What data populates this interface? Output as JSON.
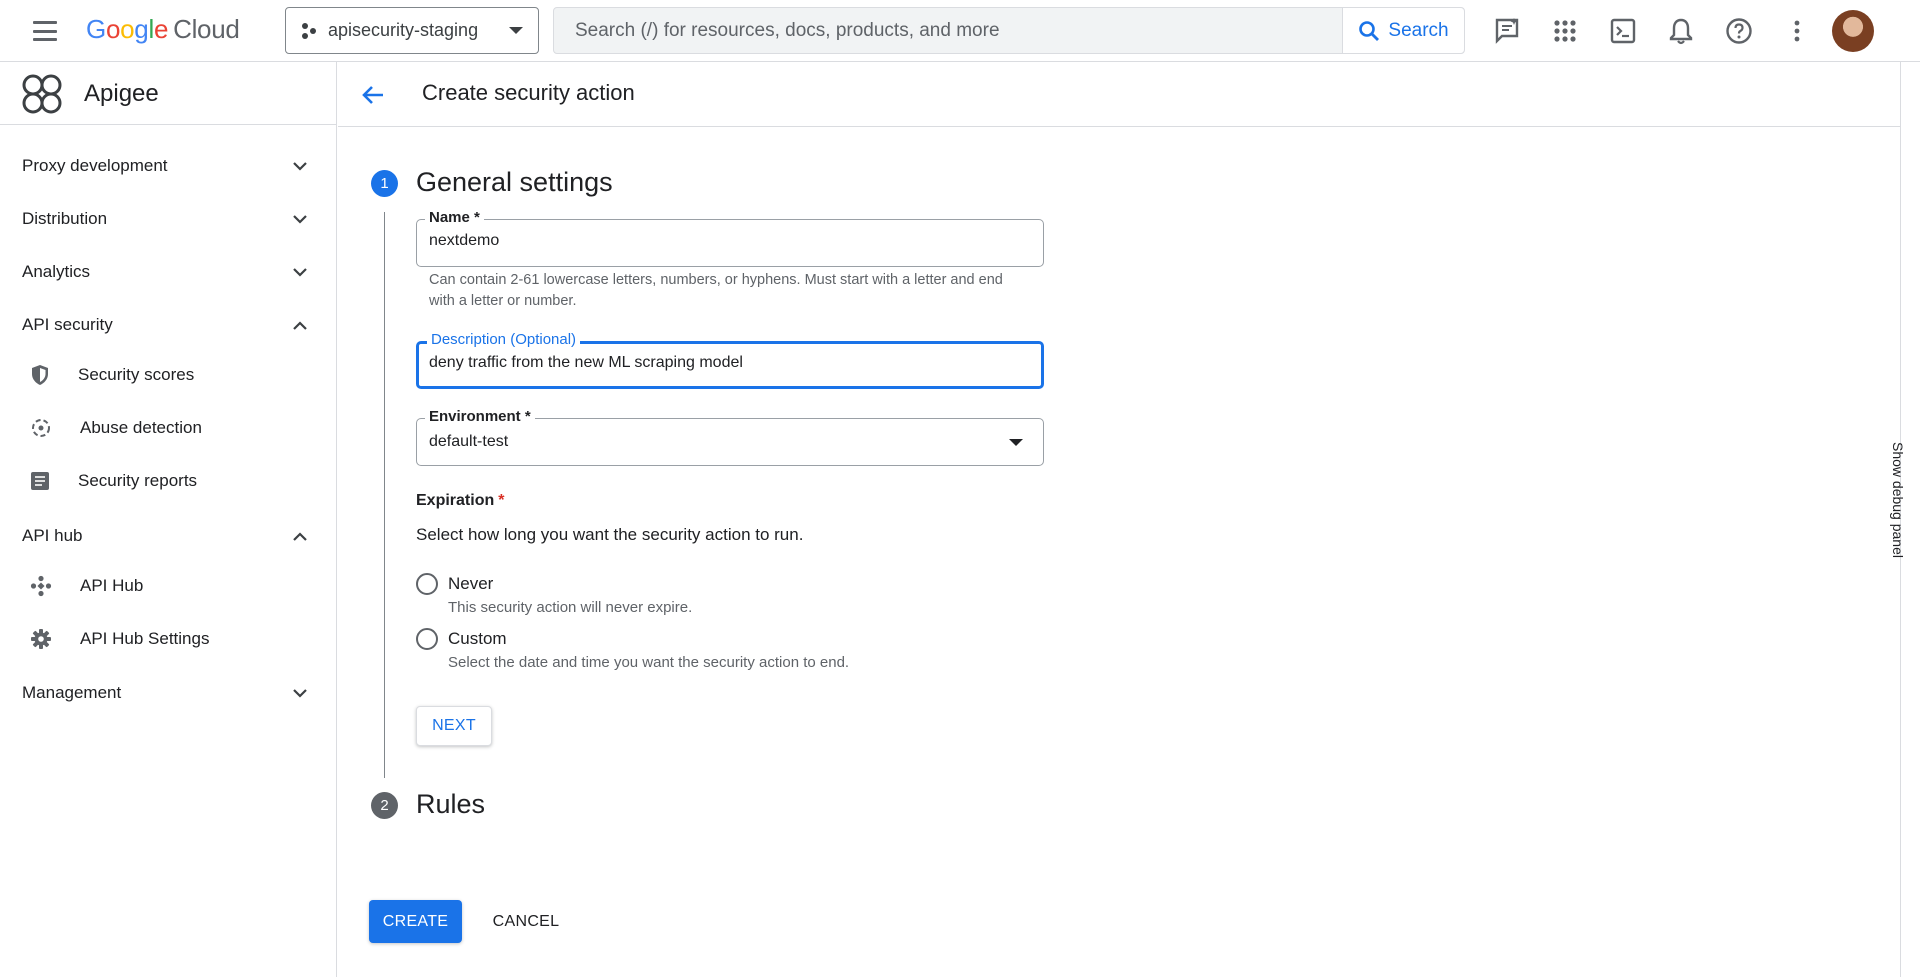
{
  "topbar": {
    "logo_google": [
      "G",
      "o",
      "o",
      "g",
      "l",
      "e"
    ],
    "logo_cloud": "Cloud",
    "project": "apisecurity-staging",
    "search_placeholder": "Search (/) for resources, docs, products, and more",
    "search_button": "Search"
  },
  "sidebar": {
    "brand": "Apigee",
    "sections": [
      {
        "label": "Proxy development",
        "expanded": false
      },
      {
        "label": "Distribution",
        "expanded": false
      },
      {
        "label": "Analytics",
        "expanded": false
      },
      {
        "label": "API security",
        "expanded": true
      },
      {
        "label": "API hub",
        "expanded": true
      },
      {
        "label": "Management",
        "expanded": false
      }
    ],
    "api_security_items": [
      "Security scores",
      "Abuse detection",
      "Security reports"
    ],
    "api_hub_items": [
      "API Hub",
      "API Hub Settings"
    ]
  },
  "header": {
    "title": "Create security action"
  },
  "step1": {
    "number": "1",
    "title": "General settings",
    "name_label": "Name *",
    "name_value": "nextdemo",
    "name_hint": "Can contain 2-61 lowercase letters, numbers, or hyphens. Must start with a letter and end with a letter or number.",
    "description_label": "Description (Optional)",
    "description_value": "deny traffic from the new ML scraping model",
    "environment_label": "Environment *",
    "environment_value": "default-test",
    "expiration_label": "Expiration",
    "expiration_required": "*",
    "expiration_desc": "Select how long you want the security action to run.",
    "options": [
      {
        "label": "Never",
        "hint": "This security action will never expire."
      },
      {
        "label": "Custom",
        "hint": "Select the date and time you want the security action to end."
      }
    ],
    "next_button": "NEXT"
  },
  "step2": {
    "number": "2",
    "title": "Rules"
  },
  "actions": {
    "create": "CREATE",
    "cancel": "CANCEL"
  },
  "debug_panel": "Show debug panel",
  "colors": {
    "primary": "#1a73e8",
    "step_active": "#1a73e8",
    "step_inactive": "#5f6368",
    "required": "#d93025"
  }
}
